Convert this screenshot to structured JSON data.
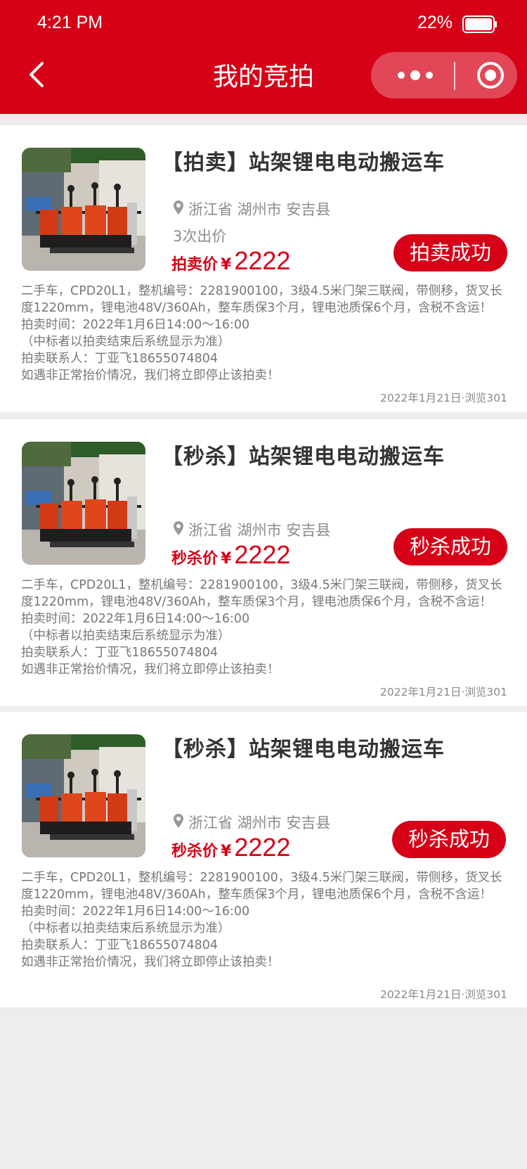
{
  "status_bar": {
    "time": "4:21 PM",
    "battery": "22%"
  },
  "nav": {
    "title": "我的竞拍"
  },
  "colors": {
    "brand": "#d60017",
    "background": "#ededed"
  },
  "icons": {
    "back": "chevron-left-icon",
    "more": "more-dots-icon",
    "close": "target-icon",
    "location": "location-pin-icon"
  },
  "cards": [
    {
      "title": "【拍卖】站架锂电电动搬运车",
      "location": "浙江省 湖州市 安吉县",
      "bids": "3次出价",
      "price_label": "拍卖价",
      "currency": "¥",
      "price": "2222",
      "status": "拍卖成功",
      "desc": [
        "二手车，CPD20L1，整机编号：2281900100，3级4.5米门架三联阀，带侧移，货叉长",
        "度1220mm，锂电池48V/360Ah，整车质保3个月，锂电池质保6个月，含税不含运！",
        "拍卖时间：2022年1月6日14:00～16:00",
        "（中标者以拍卖结束后系统显示为准）",
        "拍卖联系人：丁亚飞18655074804",
        "如遇非正常抬价情况，我们将立即停止该拍卖！"
      ],
      "meta": "2022年1月21日·浏览301"
    },
    {
      "title": "【秒杀】站架锂电电动搬运车",
      "location": "浙江省 湖州市 安吉县",
      "price_label": "秒杀价",
      "currency": "¥",
      "price": "2222",
      "status": "秒杀成功",
      "desc": [
        "二手车，CPD20L1，整机编号：2281900100，3级4.5米门架三联阀，带侧移，货叉长",
        "度1220mm，锂电池48V/360Ah，整车质保3个月，锂电池质保6个月，含税不含运！",
        "拍卖时间：2022年1月6日14:00～16:00",
        "（中标者以拍卖结束后系统显示为准）",
        "拍卖联系人：丁亚飞18655074804",
        "如遇非正常抬价情况，我们将立即停止该拍卖！"
      ],
      "meta": "2022年1月21日·浏览301"
    },
    {
      "title": "【秒杀】站架锂电电动搬运车",
      "location": "浙江省 湖州市 安吉县",
      "price_label": "秒杀价",
      "currency": "¥",
      "price": "2222",
      "status": "秒杀成功",
      "desc": [
        "二手车，CPD20L1，整机编号：2281900100，3级4.5米门架三联阀，带侧移，货叉长",
        "度1220mm，锂电池48V/360Ah，整车质保3个月，锂电池质保6个月，含税不含运！",
        "拍卖时间：2022年1月6日14:00～16:00",
        "（中标者以拍卖结束后系统显示为准）",
        "拍卖联系人：丁亚飞18655074804",
        "如遇非正常抬价情况，我们将立即停止该拍卖！"
      ],
      "meta": "2022年1月21日·浏览301"
    }
  ]
}
